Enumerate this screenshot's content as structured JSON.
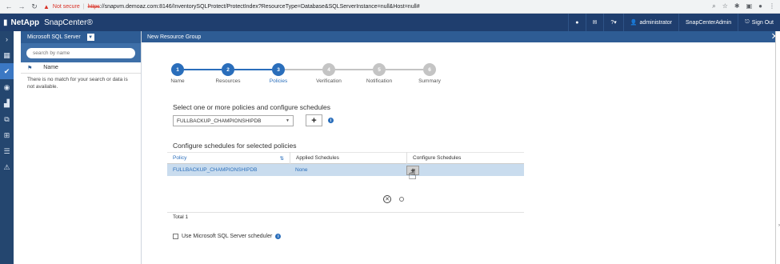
{
  "browser": {
    "security_label": "Not secure",
    "url_scheme": "https",
    "url_rest": "://snapvm.demoaz.com:8146/InventorySQLProtect/ProtectIndex?ResourceType=Database&SQLServerInstance=null&Host=null#"
  },
  "header": {
    "brand": "NetApp",
    "product": "SnapCenter®",
    "user": "administrator",
    "role": "SnapCenterAdmin",
    "sign_out": "Sign Out"
  },
  "resource_panel": {
    "plugin": "Microsoft SQL Server",
    "search_placeholder": "search by name",
    "column_name": "Name",
    "empty_message": "There is no match for your search or data is not available."
  },
  "main": {
    "title": "New Resource Group",
    "steps": [
      {
        "number": "1",
        "label": "Name",
        "state": "done"
      },
      {
        "number": "2",
        "label": "Resources",
        "state": "done"
      },
      {
        "number": "3",
        "label": "Policies",
        "state": "active"
      },
      {
        "number": "4",
        "label": "Verification",
        "state": "todo"
      },
      {
        "number": "5",
        "label": "Notification",
        "state": "todo"
      },
      {
        "number": "6",
        "label": "Summary",
        "state": "todo"
      }
    ],
    "select_title": "Select one or more policies and configure schedules",
    "selected_policy": "FULLBACKUP_CHAMPIONSHIPDB",
    "add_label": "+",
    "schedules_title": "Configure schedules for selected policies",
    "table": {
      "headers": [
        "Policy",
        "Applied Schedules",
        "Configure Schedules"
      ],
      "rows": [
        {
          "policy": "FULLBACKUP_CHAMPIONSHIPDB",
          "applied": "None",
          "configure": "+"
        }
      ]
    },
    "total": "Total 1",
    "sql_scheduler_label": "Use Microsoft SQL Server scheduler"
  },
  "colors": {
    "header_bg": "#1f3e6e",
    "accent": "#2a6ebb",
    "step_done": "#2a6ebb",
    "step_todo": "#c4c4c4",
    "selected_row": "#c9dcee"
  }
}
